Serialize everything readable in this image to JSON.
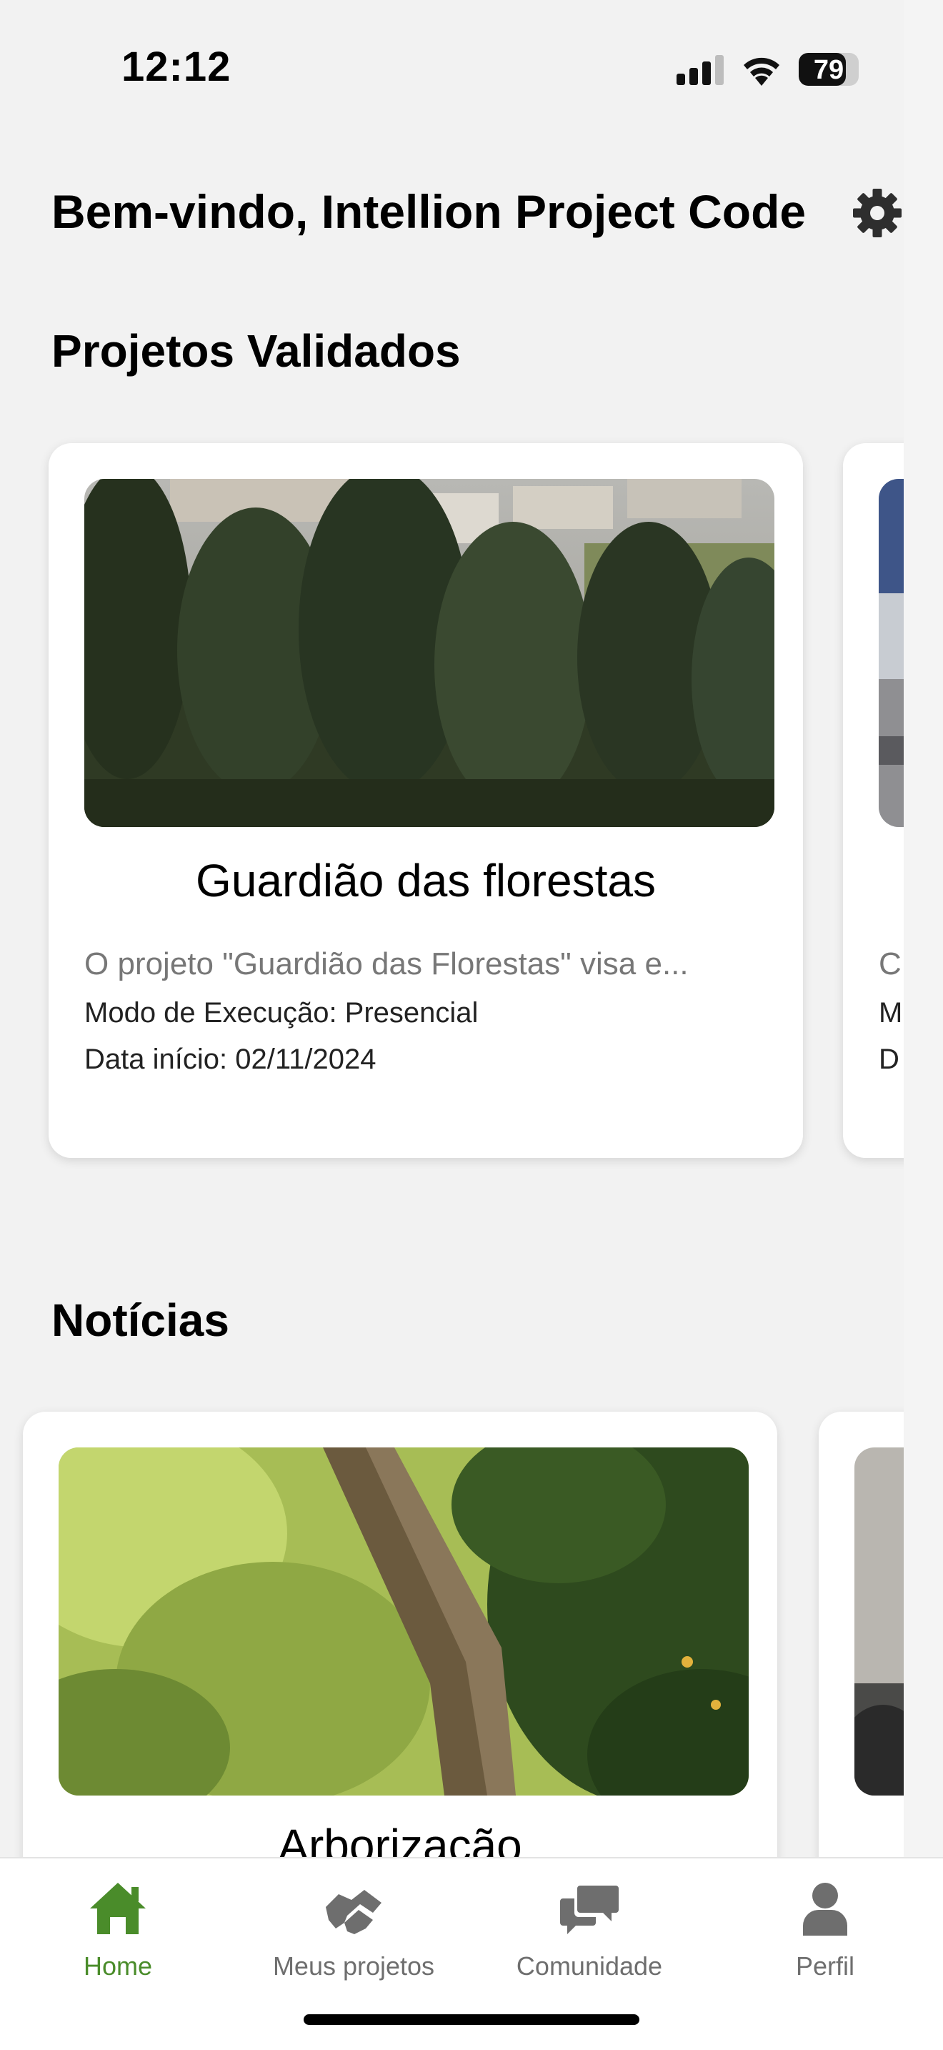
{
  "status_bar": {
    "time": "12:12",
    "battery_percent": "79",
    "battery_level": 0.79,
    "signal_bars_active": 3
  },
  "header": {
    "welcome": "Bem-vindo, Intellion Project Code",
    "settings_icon": "gear-icon"
  },
  "validated_projects": {
    "title": "Projetos Validados",
    "cards": [
      {
        "title": "Guardião das florestas",
        "description": "O projeto \"Guardião das Florestas\" visa e...",
        "mode": "Modo de Execução: Presencial",
        "start_date": "Data início: 02/11/2024"
      },
      {
        "title": "",
        "description": "C",
        "mode": "M",
        "start_date": "D"
      }
    ]
  },
  "news": {
    "title": "Notícias",
    "cards": [
      {
        "title": "Arborização"
      }
    ]
  },
  "tabbar": {
    "items": [
      {
        "label": "Home",
        "icon": "home-icon",
        "active": true
      },
      {
        "label": "Meus projetos",
        "icon": "handshake-icon",
        "active": false
      },
      {
        "label": "Comunidade",
        "icon": "chat-bubbles-icon",
        "active": false
      },
      {
        "label": "Perfil",
        "icon": "person-icon",
        "active": false
      }
    ]
  },
  "colors": {
    "accent": "#4a8c2a",
    "inactive": "#6e6e6e",
    "background": "#f2f2f2"
  }
}
